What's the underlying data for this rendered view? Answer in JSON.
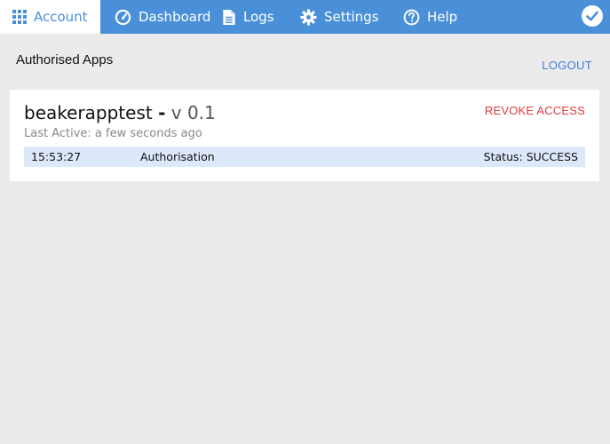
{
  "nav": {
    "tabs": [
      {
        "label": "Account",
        "icon": "grid-icon",
        "active": true
      },
      {
        "label": "Dashboard",
        "icon": "gauge-icon"
      },
      {
        "label": "Logs",
        "icon": "document-icon"
      },
      {
        "label": "Settings",
        "icon": "gear-icon"
      },
      {
        "label": "Help",
        "icon": "help-icon"
      }
    ],
    "status_icon": "check-circle-icon"
  },
  "page": {
    "section_title": "Authorised Apps",
    "logout_label": "LOGOUT"
  },
  "app": {
    "name": "beakerapptest",
    "separator": "-",
    "version": "v 0.1",
    "last_active": "Last Active: a few seconds ago",
    "revoke_label": "REVOKE ACCESS",
    "log": {
      "time": "15:53:27",
      "event": "Authorisation",
      "status": "Status: SUCCESS"
    }
  },
  "colors": {
    "nav_bg": "#4a90d9",
    "revoke": "#e03b3b",
    "link": "#3b7fd6",
    "log_row_bg": "#dde9fb"
  }
}
